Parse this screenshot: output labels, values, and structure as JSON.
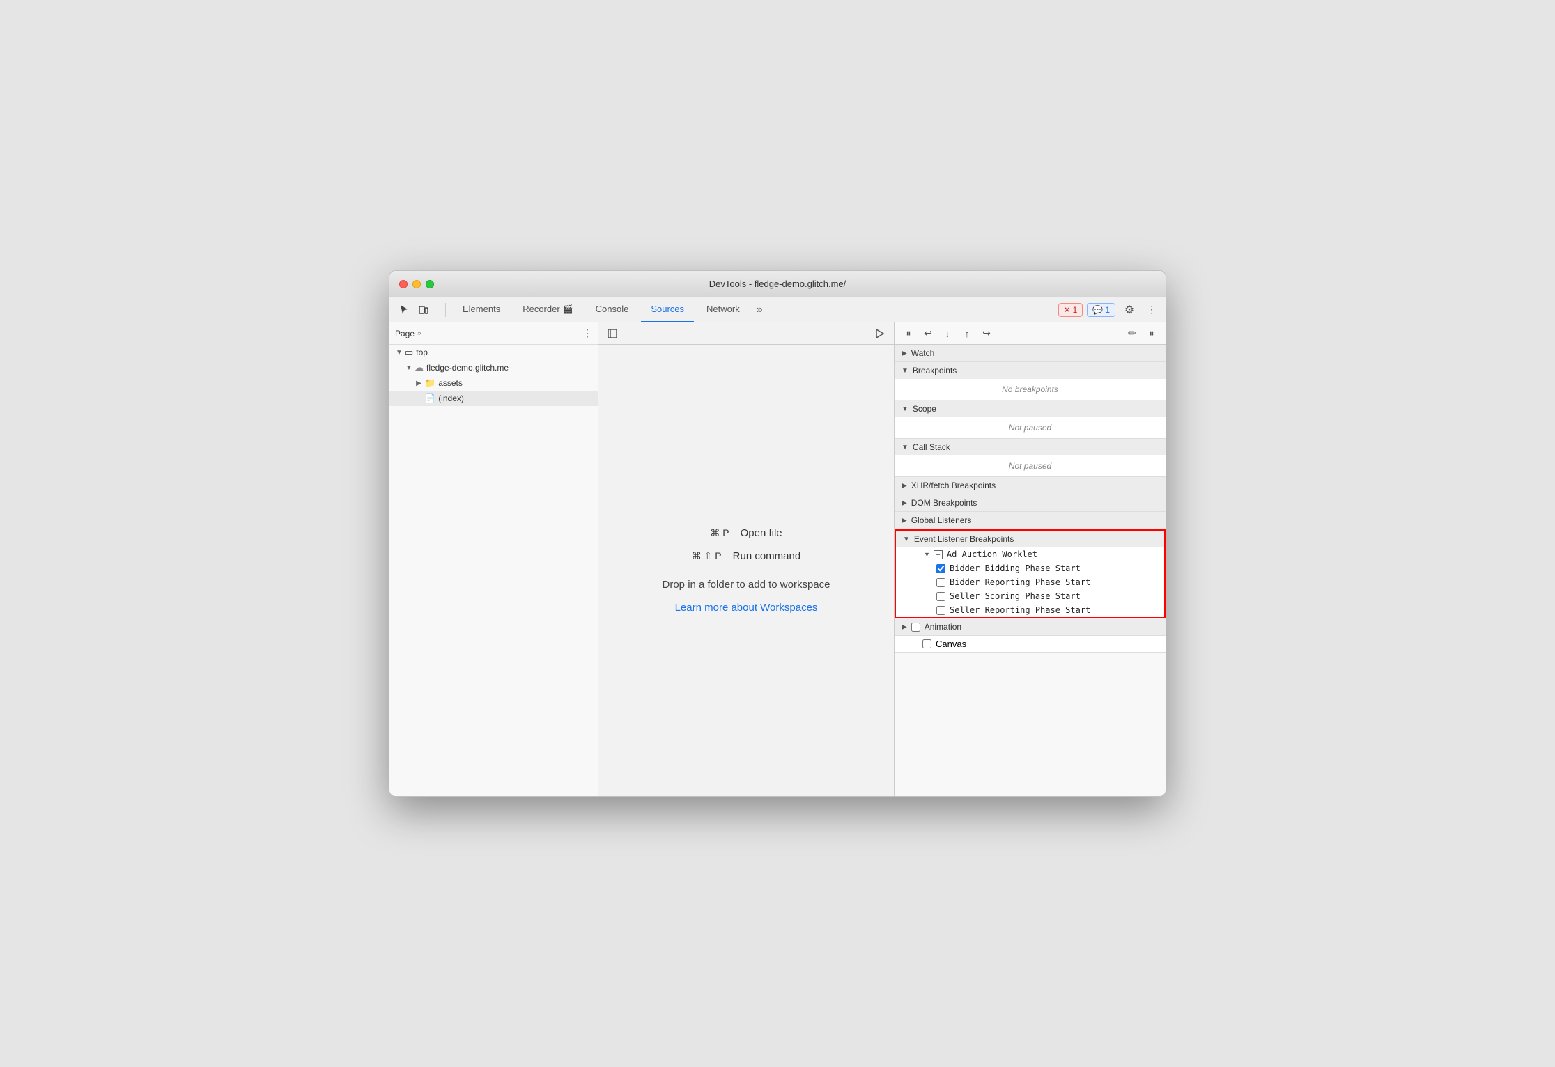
{
  "window": {
    "title": "DevTools - fledge-demo.glitch.me/"
  },
  "toolbar": {
    "tabs": [
      "Elements",
      "Recorder",
      "Console",
      "Sources",
      "Network"
    ],
    "active_tab": "Sources",
    "more_tabs": "»",
    "error_badge": "1",
    "info_badge": "1"
  },
  "left_sidebar": {
    "header_label": "Page",
    "header_more": "»",
    "tree": [
      {
        "level": 0,
        "type": "folder",
        "label": "top",
        "expanded": true
      },
      {
        "level": 1,
        "type": "cloud",
        "label": "fledge-demo.glitch.me",
        "expanded": true
      },
      {
        "level": 2,
        "type": "folder",
        "label": "assets",
        "expanded": false
      },
      {
        "level": 2,
        "type": "file",
        "label": "(index)",
        "selected": true
      }
    ]
  },
  "center_panel": {
    "shortcut1_keys": "⌘ P",
    "shortcut1_label": "Open file",
    "shortcut2_keys": "⌘ ⇧ P",
    "shortcut2_label": "Run command",
    "workspace_text": "Drop in a folder to add to workspace",
    "workspace_link": "Learn more about Workspaces"
  },
  "right_panel": {
    "sections": [
      {
        "label": "Watch",
        "expanded": false
      },
      {
        "label": "Breakpoints",
        "expanded": true,
        "body": "No breakpoints",
        "italic": true
      },
      {
        "label": "Scope",
        "expanded": true,
        "body": "Not paused",
        "italic": true
      },
      {
        "label": "Call Stack",
        "expanded": true,
        "body": "Not paused",
        "italic": true
      },
      {
        "label": "XHR/fetch Breakpoints",
        "expanded": false
      },
      {
        "label": "DOM Breakpoints",
        "expanded": false
      },
      {
        "label": "Global Listeners",
        "expanded": false
      }
    ],
    "event_listener_breakpoints": {
      "section_label": "Event Listener Breakpoints",
      "highlighted": true,
      "groups": [
        {
          "label": "Ad Auction Worklet",
          "expanded": true,
          "items": [
            {
              "label": "Bidder Bidding Phase Start",
              "checked": true
            },
            {
              "label": "Bidder Reporting Phase Start",
              "checked": false
            },
            {
              "label": "Seller Scoring Phase Start",
              "checked": false
            },
            {
              "label": "Seller Reporting Phase Start",
              "checked": false
            }
          ]
        }
      ]
    },
    "animation_section": {
      "label": "Animation",
      "expanded": false,
      "sub_item": "Canvas"
    }
  }
}
